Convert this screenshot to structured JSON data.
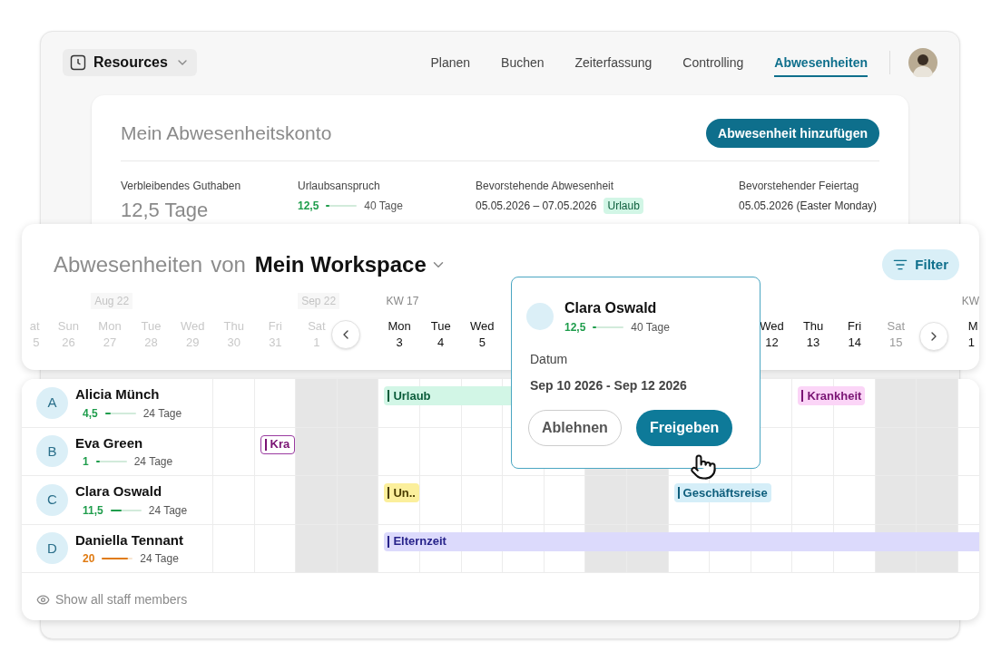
{
  "app_switcher": {
    "label": "Resources"
  },
  "nav": [
    {
      "label": "Planen",
      "selected": false
    },
    {
      "label": "Buchen",
      "selected": false
    },
    {
      "label": "Zeiterfassung",
      "selected": false
    },
    {
      "label": "Controlling",
      "selected": false
    },
    {
      "label": "Abwesenheiten",
      "selected": true
    }
  ],
  "account": {
    "title": "Mein Abwesenheitskonto",
    "add_button": "Abwesenheit hinzufügen",
    "stats": [
      {
        "kind": "big",
        "label": "Verbleibendes Guthaben",
        "value": "12,5 Tage"
      },
      {
        "kind": "meter",
        "label": "Urlaubsanspruch",
        "value": "12,5",
        "level": 0.1,
        "color": "#1f9d4c",
        "total": "40 Tage"
      },
      {
        "kind": "badge",
        "label": "Bevorstehende Abwesenheit",
        "value": "05.05.2026 – 07.05.2026",
        "badge": "Urlaub"
      },
      {
        "kind": "text",
        "label": "Bevorstehender Feiertag",
        "value": "05.05.2026 (Easter Monday)"
      }
    ]
  },
  "calendar": {
    "title_prefix": "Abwesenheiten",
    "title_join": "von",
    "workspace": "Mein Workspace",
    "filter_button": "Filter",
    "labels": [
      {
        "kind": "month",
        "text": "Aug 22"
      },
      {
        "kind": "month",
        "text": "Sep 22"
      },
      {
        "kind": "week",
        "text": "KW 17"
      },
      {
        "kind": "week",
        "text": "KW"
      }
    ],
    "days": [
      {
        "day": "at",
        "date": "5",
        "past": true
      },
      {
        "day": "Sun",
        "date": "26",
        "past": true
      },
      {
        "day": "Mon",
        "date": "27",
        "past": true
      },
      {
        "day": "Tue",
        "date": "28",
        "past": true
      },
      {
        "day": "Wed",
        "date": "29",
        "past": true
      },
      {
        "day": "Thu",
        "date": "30",
        "past": true
      },
      {
        "day": "Fri",
        "date": "31",
        "past": true
      },
      {
        "day": "Sat",
        "date": "1",
        "past": true
      },
      {
        "day": "Mon",
        "date": "3",
        "past": false,
        "weekend": false
      },
      {
        "day": "Tue",
        "date": "4",
        "past": false,
        "weekend": false
      },
      {
        "day": "Wed",
        "date": "5",
        "past": false,
        "weekend": false
      },
      {
        "day": "Wed",
        "date": "12",
        "past": false,
        "weekend": false
      },
      {
        "day": "Thu",
        "date": "13",
        "past": false,
        "weekend": false
      },
      {
        "day": "Fri",
        "date": "14",
        "past": false,
        "weekend": false
      },
      {
        "day": "Sat",
        "date": "15",
        "past": false,
        "weekend": true
      },
      {
        "day": "M",
        "date": "1",
        "past": false,
        "weekend": false
      }
    ],
    "columns": [
      {
        "weekend": false
      },
      {
        "weekend": false
      },
      {
        "weekend": true
      },
      {
        "weekend": true
      },
      {
        "weekend": false
      },
      {
        "weekend": false
      },
      {
        "weekend": false
      },
      {
        "weekend": false
      },
      {
        "weekend": false
      },
      {
        "weekend": true
      },
      {
        "weekend": true
      },
      {
        "weekend": false
      },
      {
        "weekend": false
      },
      {
        "weekend": false
      },
      {
        "weekend": false
      },
      {
        "weekend": false
      },
      {
        "weekend": true
      },
      {
        "weekend": true
      },
      {
        "weekend": false
      }
    ],
    "people": [
      {
        "initial": "A",
        "name": "Alicia Münch",
        "balance": "4,5",
        "level": 0.18,
        "color": "#1f9d4c",
        "total": "24 Tage",
        "events": [
          {
            "kind": "vacation",
            "label": "Urlaub"
          },
          {
            "kind": "sick",
            "label": "Krankheit"
          }
        ]
      },
      {
        "initial": "B",
        "name": "Eva Green",
        "balance": "1",
        "level": 0.12,
        "color": "#1f9d4c",
        "total": "24 Tage",
        "events": [
          {
            "kind": "sick_pending",
            "label": "Kra"
          }
        ]
      },
      {
        "initial": "C",
        "name": "Clara Oswald",
        "balance": "11,5",
        "level": 0.36,
        "color": "#1f9d4c",
        "total": "24 Tage",
        "events": [
          {
            "kind": "unpaid",
            "label": "Un.."
          },
          {
            "kind": "business",
            "label": "Geschäftsreise"
          }
        ]
      },
      {
        "initial": "D",
        "name": "Daniella Tennant",
        "balance": "20",
        "level": 0.85,
        "color": "#e07b12",
        "total": "24 Tage",
        "events": [
          {
            "kind": "parental",
            "label": "Elternzeit"
          }
        ]
      }
    ],
    "show_all": "Show all staff members"
  },
  "popover": {
    "name": "Clara Oswald",
    "balance": "12,5",
    "level": 0.1,
    "color": "#1f9d4c",
    "total": "40 Tage",
    "date_label": "Datum",
    "date_range": "Sep 10 2026 - Sep 12 2026",
    "reject_button": "Ablehnen",
    "approve_button": "Freigeben"
  }
}
